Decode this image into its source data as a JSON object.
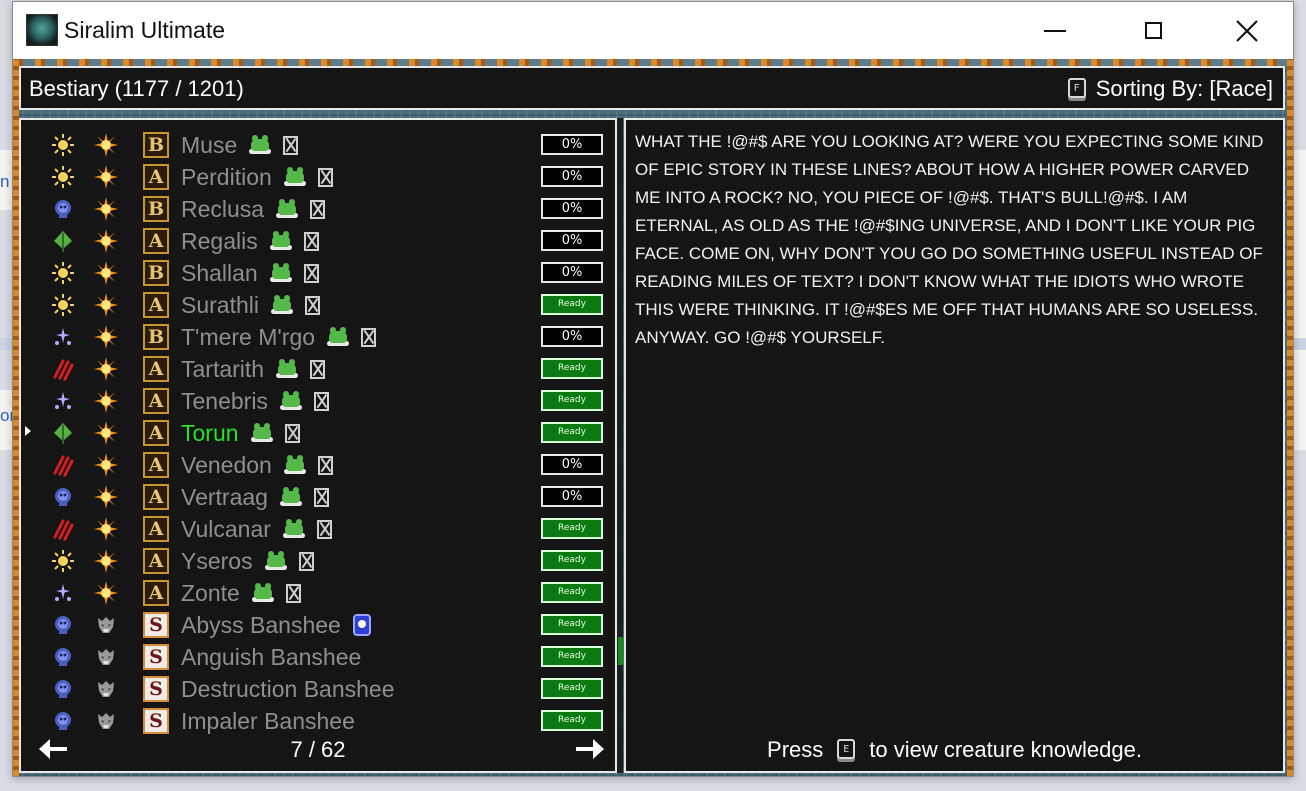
{
  "window": {
    "title": "Siralim Ultimate",
    "controls": {
      "minimize_icon": "minimize-icon",
      "maximize_icon": "maximize-icon",
      "close_icon": "close-icon"
    }
  },
  "header": {
    "title": "Bestiary (1177 / 1201)",
    "sort_key": "F",
    "sort_label": "Sorting By: [Race]"
  },
  "creatures": [
    {
      "name": "Muse",
      "class": "life",
      "race_icon": "sunburst",
      "rarity": "B",
      "owned": true,
      "skull": false,
      "status": "0%"
    },
    {
      "name": "Perdition",
      "class": "life",
      "race_icon": "sunburst",
      "rarity": "A",
      "owned": true,
      "skull": false,
      "status": "0%"
    },
    {
      "name": "Reclusa",
      "class": "death",
      "race_icon": "sunburst",
      "rarity": "B",
      "owned": true,
      "skull": false,
      "status": "0%"
    },
    {
      "name": "Regalis",
      "class": "nature",
      "race_icon": "sunburst",
      "rarity": "A",
      "owned": true,
      "skull": false,
      "status": "0%"
    },
    {
      "name": "Shallan",
      "class": "life",
      "race_icon": "sunburst",
      "rarity": "B",
      "owned": true,
      "skull": false,
      "status": "0%"
    },
    {
      "name": "Surathli",
      "class": "life",
      "race_icon": "sunburst",
      "rarity": "A",
      "owned": true,
      "skull": false,
      "status": "Ready"
    },
    {
      "name": "T'mere M'rgo",
      "class": "sorcery",
      "race_icon": "sunburst",
      "rarity": "B",
      "owned": true,
      "skull": false,
      "status": "0%"
    },
    {
      "name": "Tartarith",
      "class": "chaos",
      "race_icon": "sunburst",
      "rarity": "A",
      "owned": true,
      "skull": false,
      "status": "Ready"
    },
    {
      "name": "Tenebris",
      "class": "sorcery",
      "race_icon": "sunburst",
      "rarity": "A",
      "owned": true,
      "skull": false,
      "status": "Ready"
    },
    {
      "name": "Torun",
      "class": "nature",
      "race_icon": "sunburst",
      "rarity": "A",
      "owned": true,
      "skull": false,
      "status": "Ready",
      "selected": true
    },
    {
      "name": "Venedon",
      "class": "chaos",
      "race_icon": "sunburst",
      "rarity": "A",
      "owned": true,
      "skull": false,
      "status": "0%"
    },
    {
      "name": "Vertraag",
      "class": "death",
      "race_icon": "sunburst",
      "rarity": "A",
      "owned": true,
      "skull": false,
      "status": "0%"
    },
    {
      "name": "Vulcanar",
      "class": "chaos",
      "race_icon": "sunburst",
      "rarity": "A",
      "owned": true,
      "skull": false,
      "status": "Ready"
    },
    {
      "name": "Yseros",
      "class": "life",
      "race_icon": "sunburst",
      "rarity": "A",
      "owned": true,
      "skull": false,
      "status": "Ready"
    },
    {
      "name": "Zonte",
      "class": "sorcery",
      "race_icon": "sunburst",
      "rarity": "A",
      "owned": true,
      "skull": false,
      "status": "Ready"
    },
    {
      "name": "Abyss Banshee",
      "class": "death",
      "race_icon": "banshee",
      "rarity": "S",
      "owned": false,
      "skull": true,
      "status": "Ready"
    },
    {
      "name": "Anguish Banshee",
      "class": "death",
      "race_icon": "banshee",
      "rarity": "S",
      "owned": false,
      "skull": false,
      "status": "Ready"
    },
    {
      "name": "Destruction Banshee",
      "class": "death",
      "race_icon": "banshee",
      "rarity": "S",
      "owned": false,
      "skull": false,
      "status": "Ready"
    },
    {
      "name": "Impaler Banshee",
      "class": "death",
      "race_icon": "banshee",
      "rarity": "S",
      "owned": false,
      "skull": false,
      "status": "Ready"
    }
  ],
  "pager": {
    "text": "7 / 62"
  },
  "description": {
    "text": "WHAT THE !@#$ ARE YOU LOOKING AT? WERE YOU EXPECTING SOME KIND OF EPIC STORY IN THESE LINES? ABOUT HOW A HIGHER POWER CARVED ME INTO A ROCK? NO, YOU PIECE OF !@#$. THAT'S BULL!@#$. I AM ETERNAL, AS OLD AS THE !@#$ING UNIVERSE, AND I DON'T LIKE YOUR PIG FACE. COME ON, WHY DON'T YOU GO DO SOMETHING USEFUL INSTEAD OF READING MILES OF TEXT? I DON'T KNOW WHAT THE IDIOTS WHO WROTE THIS WERE THINKING. IT !@#$ES ME OFF THAT HUMANS ARE SO USELESS. ANYWAY. GO !@#$ YOURSELF.",
    "press_label": "Press",
    "press_key": "E",
    "press_suffix": "to view creature knowledge."
  },
  "colors": {
    "selected_name": "#28e028",
    "ready_bg": "#0c7a12",
    "panel_bg": "#151515",
    "rarity_border": "#c9932d"
  },
  "background_fragments": {
    "left_text_1": "n",
    "left_text_2": "on"
  }
}
